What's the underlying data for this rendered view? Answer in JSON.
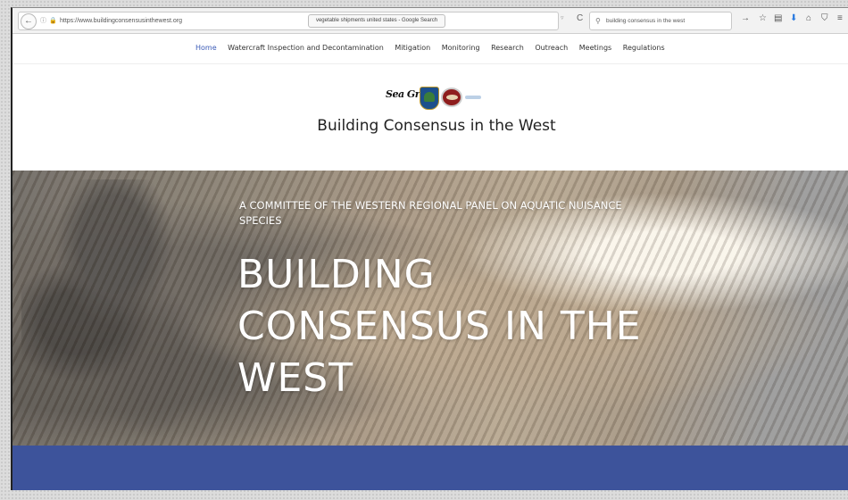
{
  "browser": {
    "url": "https://www.buildingconsensusinthewest.org",
    "suggestion_tab": "vegetable shipments united states - Google Search",
    "search_text": "building consensus in the west"
  },
  "nav": {
    "items": [
      "Home",
      "Watercraft Inspection and Decontamination",
      "Mitigation",
      "Monitoring",
      "Research",
      "Outreach",
      "Meetings",
      "Regulations"
    ],
    "active": "Home"
  },
  "header": {
    "logo_text": "Sea Grant",
    "title": "Building Consensus in the West"
  },
  "hero": {
    "subtitle": "A COMMITTEE OF THE WESTERN REGIONAL PANEL ON AQUATIC NUISANCE SPECIES",
    "title": "BUILDING CONSENSUS IN THE WEST"
  },
  "colors": {
    "active_nav": "#3b5bb7",
    "band": "#3d539b"
  },
  "icons": [
    "back-arrow-icon",
    "info-icon",
    "lock-icon",
    "reload-icon",
    "search-icon",
    "forward-arrow-icon",
    "star-icon",
    "clipboard-icon",
    "download-icon",
    "home-icon",
    "shield-icon",
    "menu-icon"
  ]
}
